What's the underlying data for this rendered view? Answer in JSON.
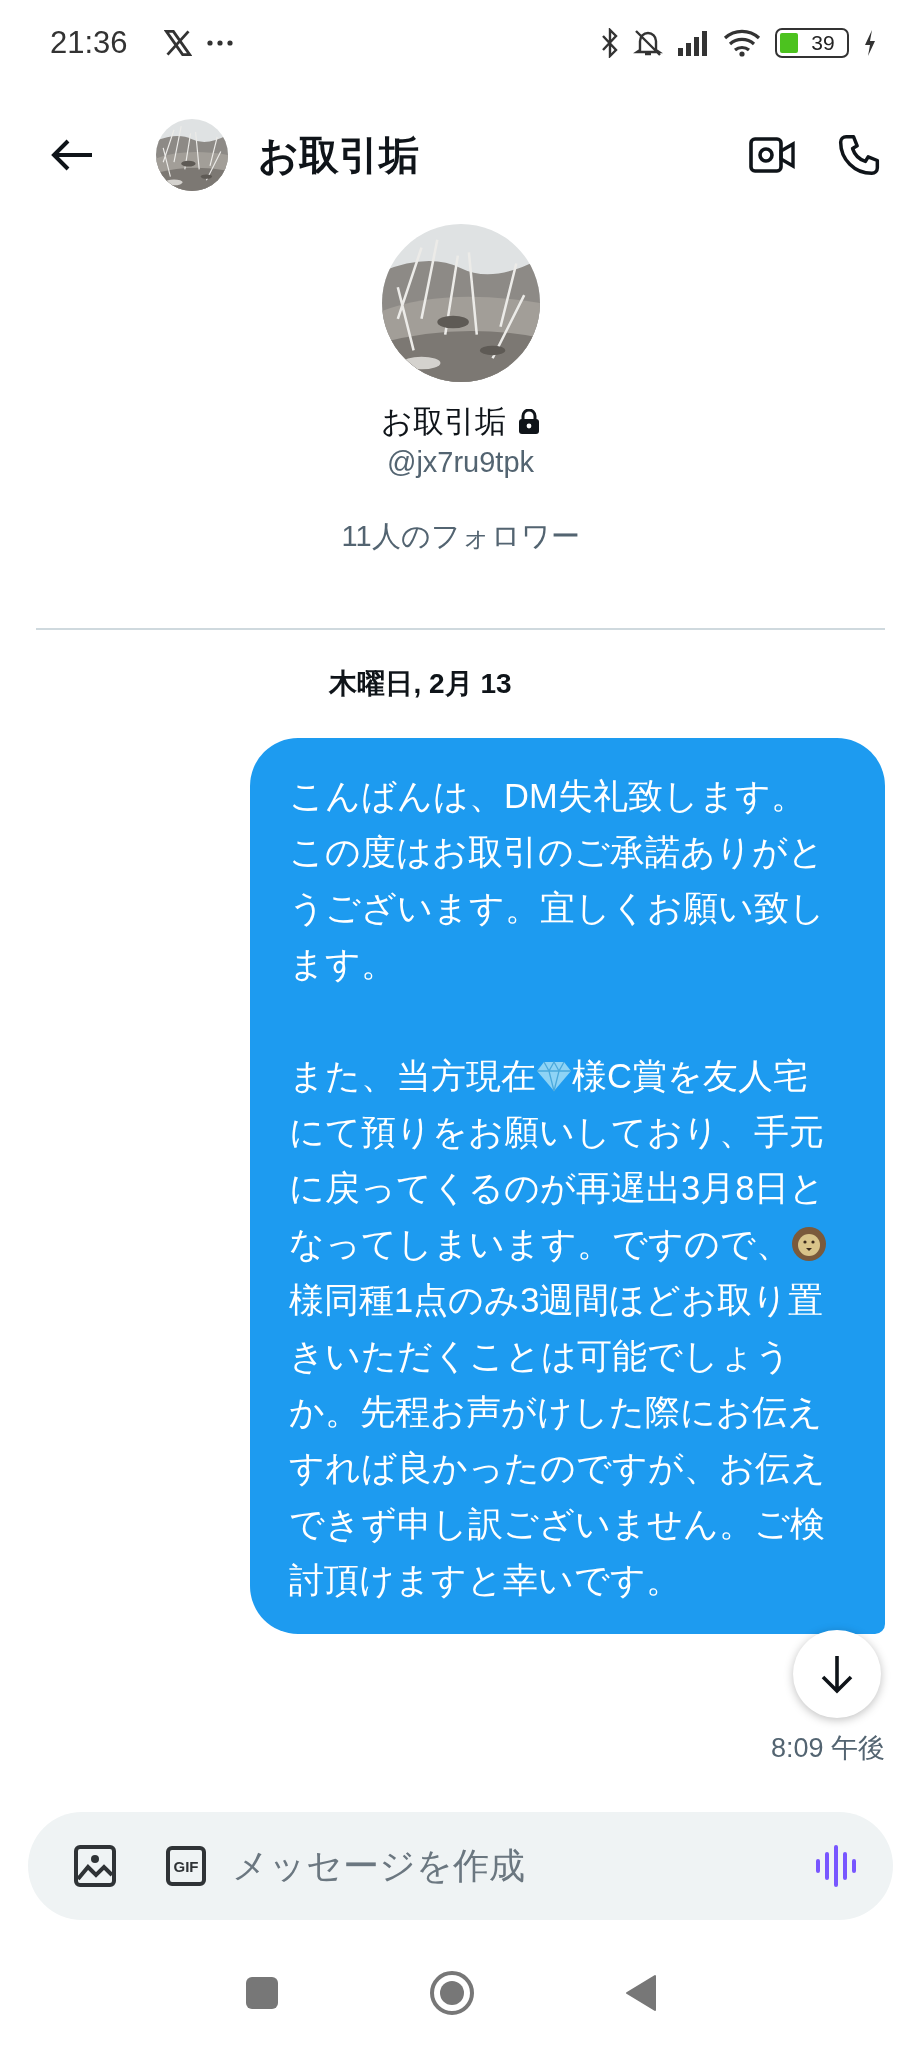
{
  "status_bar": {
    "time": "21:36",
    "battery": "39"
  },
  "header": {
    "title": "お取引垢"
  },
  "profile": {
    "name": "お取引垢",
    "protected": true,
    "handle": "@jx7ru9tpk",
    "followers": "11人のフォロワー"
  },
  "conversation": {
    "date": "木曜日, 2月 13",
    "messages": [
      {
        "paragraphs": [
          [
            {
              "kind": "text",
              "text": "こんばんは、DM失礼致します。この度はお取引のご承諾ありがとうございます。宜しくお願い致します。"
            }
          ],
          [
            {
              "kind": "text",
              "text": "また、当方現在"
            },
            {
              "kind": "gem"
            },
            {
              "kind": "text",
              "text": "様C賞を友人宅にて預りをお願いしており、手元に戻ってくるのが再遅出3月8日となってしまいます。ですので、"
            },
            {
              "kind": "lion"
            },
            {
              "kind": "text",
              "text": "様同種1点のみ3週間ほどお取り置きいただくことは可能でしょうか。先程お声がけした際にお伝えすれば良かったのですが、お伝えできず申し訳ございません。ご検討頂けますと幸いです。"
            }
          ]
        ],
        "time": "8:09 午後"
      }
    ]
  },
  "composer": {
    "gif_label": "GIF",
    "placeholder": "メッセージを作成"
  }
}
